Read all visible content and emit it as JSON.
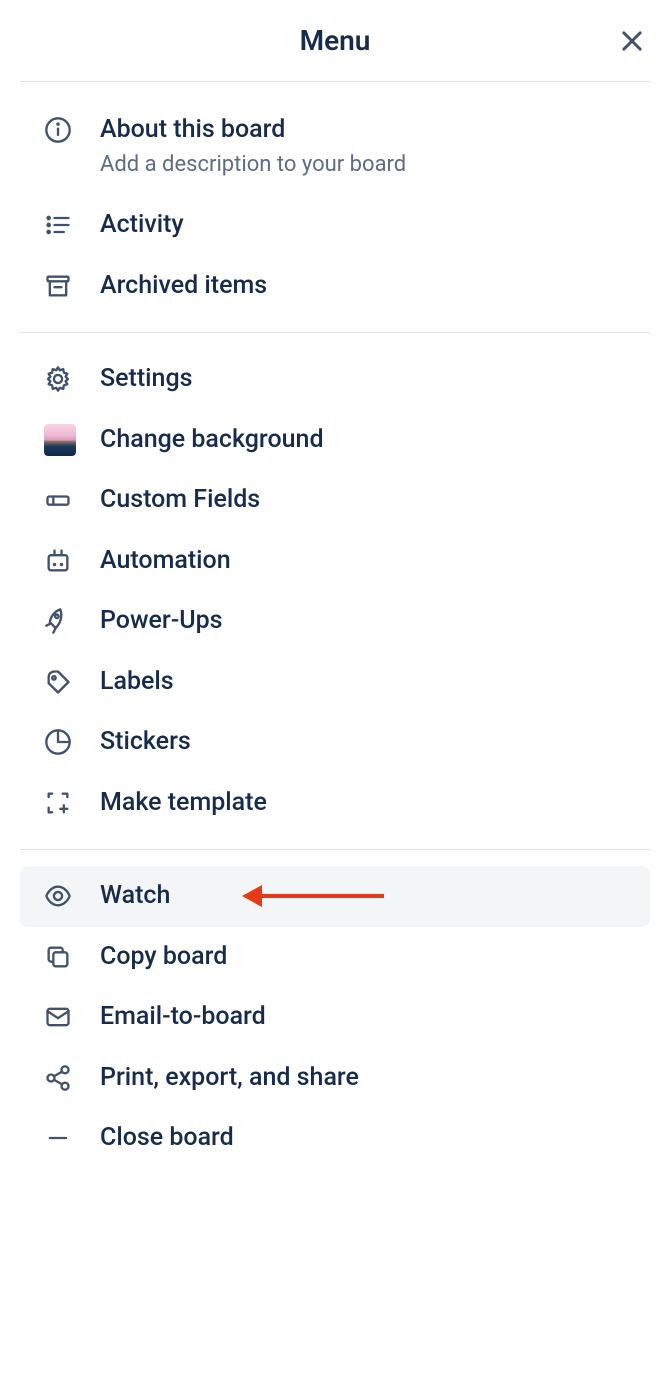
{
  "header": {
    "title": "Menu"
  },
  "sections": [
    {
      "items": [
        {
          "label": "About this board",
          "sublabel": "Add a description to your board",
          "icon": "info"
        },
        {
          "label": "Activity",
          "icon": "activity"
        },
        {
          "label": "Archived items",
          "icon": "archive"
        }
      ]
    },
    {
      "items": [
        {
          "label": "Settings",
          "icon": "gear"
        },
        {
          "label": "Change background",
          "icon": "thumbnail"
        },
        {
          "label": "Custom Fields",
          "icon": "field"
        },
        {
          "label": "Automation",
          "icon": "robot"
        },
        {
          "label": "Power-Ups",
          "icon": "rocket"
        },
        {
          "label": "Labels",
          "icon": "tag"
        },
        {
          "label": "Stickers",
          "icon": "sticker"
        },
        {
          "label": "Make template",
          "icon": "template"
        }
      ]
    },
    {
      "items": [
        {
          "label": "Watch",
          "icon": "eye",
          "highlighted": true,
          "arrow": true
        },
        {
          "label": "Copy board",
          "icon": "copy"
        },
        {
          "label": "Email-to-board",
          "icon": "mail"
        },
        {
          "label": "Print, export, and share",
          "icon": "share"
        },
        {
          "label": "Close board",
          "icon": "minus"
        }
      ]
    }
  ]
}
